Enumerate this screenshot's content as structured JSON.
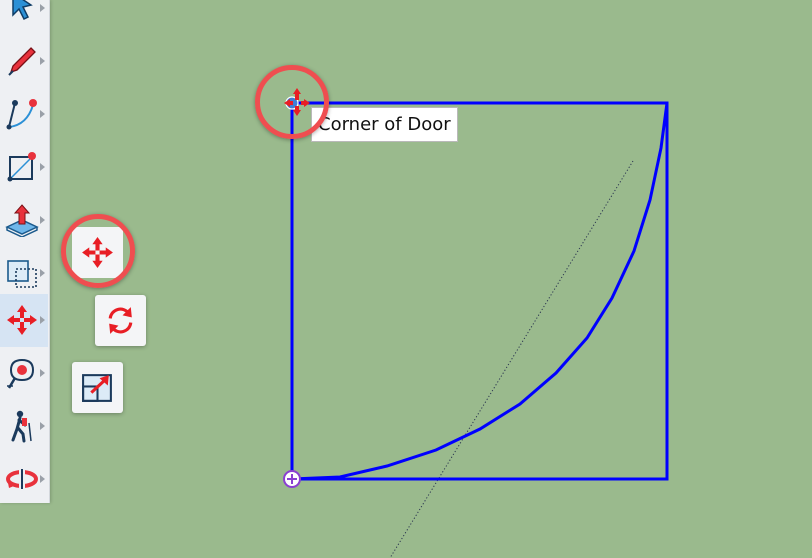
{
  "toolbar": {
    "tools": [
      {
        "name": "select",
        "icon": "select-arrow-icon"
      },
      {
        "name": "pencil",
        "icon": "pencil-icon"
      },
      {
        "name": "arc",
        "icon": "arc-icon"
      },
      {
        "name": "rectangle",
        "icon": "rectangle-icon"
      },
      {
        "name": "push-pull",
        "icon": "push-pull-icon"
      },
      {
        "name": "offset",
        "icon": "offset-icon"
      },
      {
        "name": "move",
        "icon": "move-icon",
        "active": true
      },
      {
        "name": "tape-measure",
        "icon": "tape-measure-icon"
      },
      {
        "name": "walk",
        "icon": "walk-icon"
      },
      {
        "name": "orbit",
        "icon": "orbit-icon"
      }
    ]
  },
  "flyout": {
    "items": [
      {
        "name": "move",
        "icon": "move-icon"
      },
      {
        "name": "rotate",
        "icon": "rotate-icon"
      },
      {
        "name": "scale",
        "icon": "scale-icon"
      }
    ]
  },
  "canvas": {
    "tooltip": "Corner of Door",
    "colors": {
      "background": "#9aba8d",
      "edges": "#0000ff",
      "highlight": "#ef4e50",
      "endpoint": "#8a3fd1"
    }
  }
}
